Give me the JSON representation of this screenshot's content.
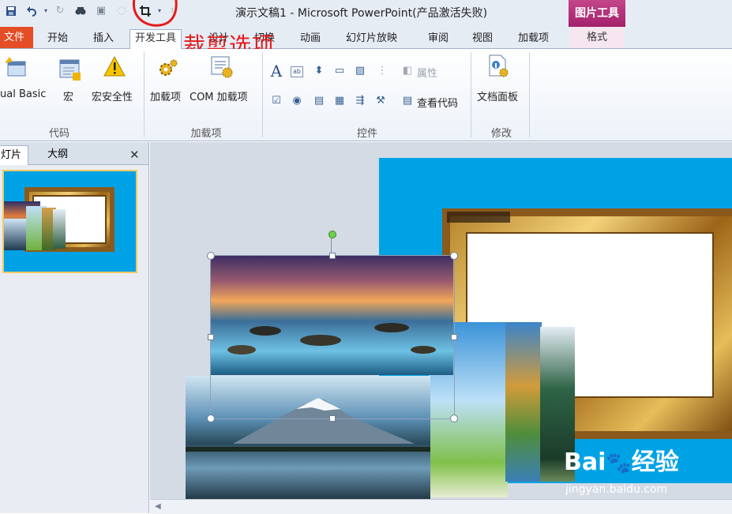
{
  "window": {
    "title": "演示文稿1 - Microsoft PowerPoint(产品激活失败)",
    "context_tab": "图片工具"
  },
  "quick_access": {
    "icons": [
      "save-icon",
      "undo-icon",
      "dropdown-icon",
      "redo-icon",
      "find-icon",
      "paste-icon",
      "lasso-icon",
      "crop-icon",
      "customize-icon"
    ]
  },
  "tabs": [
    {
      "label": "文件"
    },
    {
      "label": "开始"
    },
    {
      "label": "插入"
    },
    {
      "label": "开发工具"
    },
    {
      "label": "设计"
    },
    {
      "label": "切换"
    },
    {
      "label": "动画"
    },
    {
      "label": "幻灯片放映"
    },
    {
      "label": "审阅"
    },
    {
      "label": "视图"
    },
    {
      "label": "加载项"
    },
    {
      "label": "格式"
    }
  ],
  "annotation": {
    "text": "裁剪选项",
    "color": "#e31b1b"
  },
  "ribbon": {
    "groups": [
      {
        "label": "代码",
        "buttons": [
          "ual Basic",
          "宏",
          "宏安全性"
        ]
      },
      {
        "label": "加载项",
        "buttons": [
          "加载项",
          "COM 加载项"
        ]
      },
      {
        "label": "控件",
        "buttons": [
          "属性",
          "查看代码"
        ]
      },
      {
        "label": "修改",
        "buttons": [
          "文档面板"
        ]
      }
    ]
  },
  "left_pane": {
    "tabs": [
      "灯片",
      "大纲"
    ],
    "close_icon": "close-icon"
  },
  "watermark": {
    "brand": "Bai",
    "brand2": "经验",
    "url": "jingyan.baidu.com"
  },
  "colors": {
    "slide_bg": "#00a2e6",
    "file_tab": "#e44d26",
    "context_tab": "#b12f79",
    "annotation": "#e31b1b"
  }
}
